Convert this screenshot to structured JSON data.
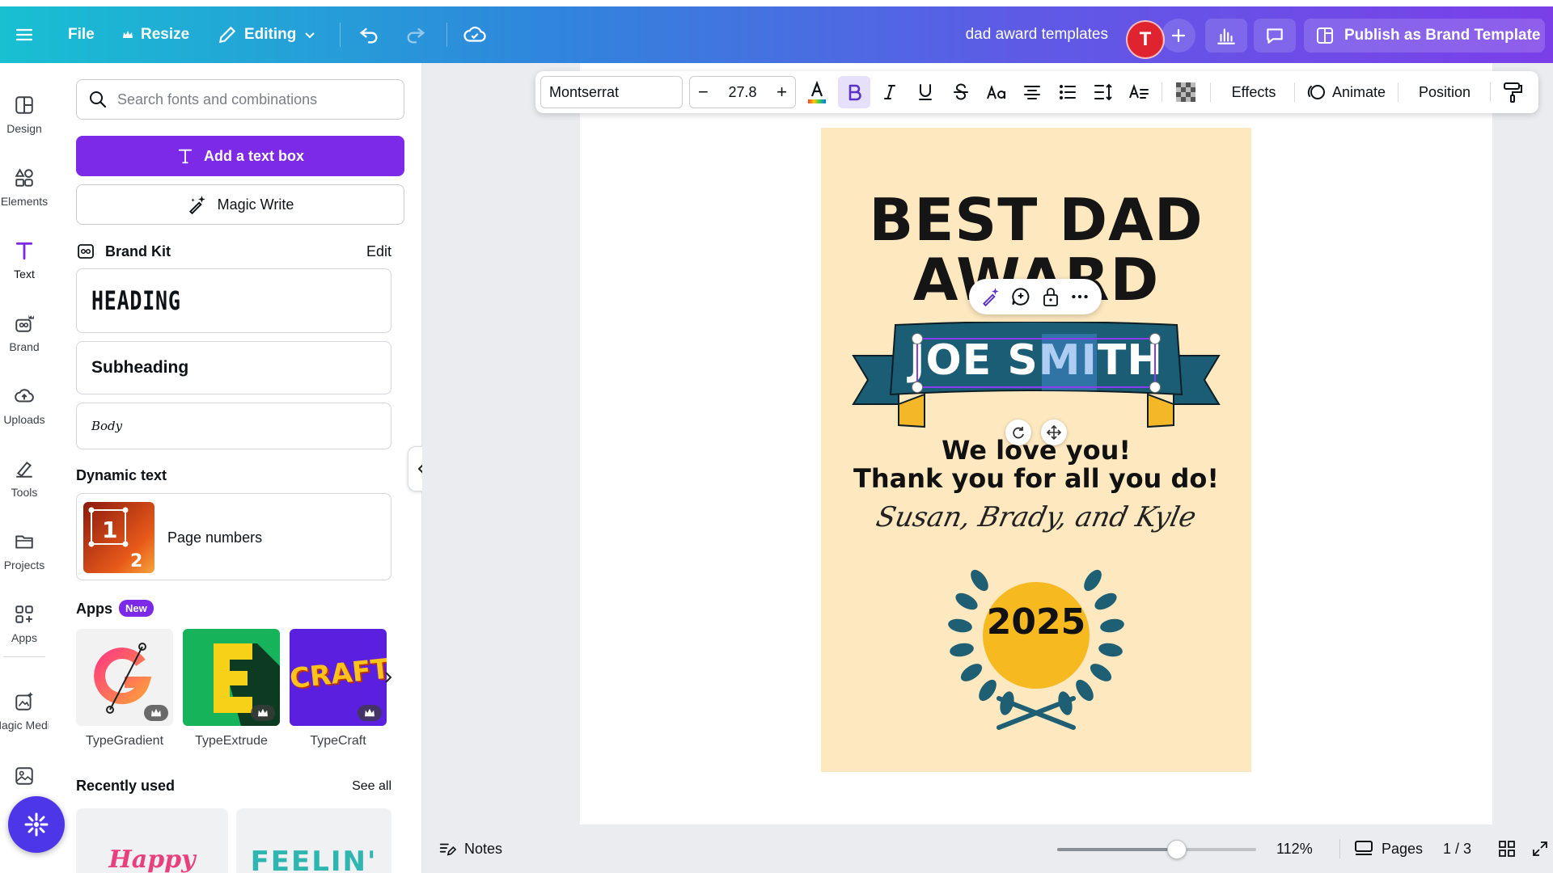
{
  "colors": {
    "accent": "#7d2ae8",
    "topbar_start": "#18c0d2",
    "topbar_end": "#7b3fe8",
    "design_bg": "#fde8bf",
    "banner": "#1b5d74",
    "laurel": "#1f5f73",
    "medal": "#f6b91f"
  },
  "topbar": {
    "menu_icon": "hamburger-icon",
    "file_label": "File",
    "resize_label": "Resize",
    "editing_label": "Editing",
    "doc_title": "dad award templates",
    "avatar_initial": "T",
    "publish_label": "Publish as Brand Template"
  },
  "rail": {
    "items": [
      {
        "label": "Design",
        "icon": "design-icon"
      },
      {
        "label": "Elements",
        "icon": "elements-icon"
      },
      {
        "label": "Text",
        "icon": "text-icon",
        "active": true
      },
      {
        "label": "Brand",
        "icon": "brand-icon"
      },
      {
        "label": "Uploads",
        "icon": "uploads-icon"
      },
      {
        "label": "Tools",
        "icon": "tools-icon"
      },
      {
        "label": "Projects",
        "icon": "projects-icon"
      },
      {
        "label": "Apps",
        "icon": "apps-icon"
      },
      {
        "label": "Magic Media",
        "icon": "magic-media-icon"
      }
    ]
  },
  "panel": {
    "search_placeholder": "Search fonts and combinations",
    "add_text_box": "Add a text box",
    "magic_write": "Magic Write",
    "brand_kit": "Brand Kit",
    "brand_kit_edit": "Edit",
    "style_heading": "HEADING",
    "style_subheading": "Subheading",
    "style_body": "Body",
    "dynamic_text": "Dynamic text",
    "page_numbers": "Page numbers",
    "apps": "Apps",
    "new_badge": "New",
    "app_tiles": [
      {
        "name": "TypeGradient"
      },
      {
        "name": "TypeExtrude"
      },
      {
        "name": "TypeCraft",
        "tile_text": "CRAFT"
      }
    ],
    "recently_used": "Recently used",
    "see_all": "See all",
    "recent_tiles": [
      "Happy",
      "FEELIN'"
    ]
  },
  "text_toolbar": {
    "font": "Montserrat",
    "size": "27.8",
    "effects": "Effects",
    "animate": "Animate",
    "position": "Position"
  },
  "design": {
    "title_line1": "BEST DAD",
    "title_line2": "AWARD",
    "name": "JOE SMITH",
    "message_line1": "We love you!",
    "message_line2": "Thank you for all you do!",
    "signature": "Susan, Brady, and Kyle",
    "year": "2025"
  },
  "bottombar": {
    "notes": "Notes",
    "zoom": "112%",
    "zoom_level": 0.6,
    "pages": "Pages",
    "page_counter": "1 / 3"
  }
}
